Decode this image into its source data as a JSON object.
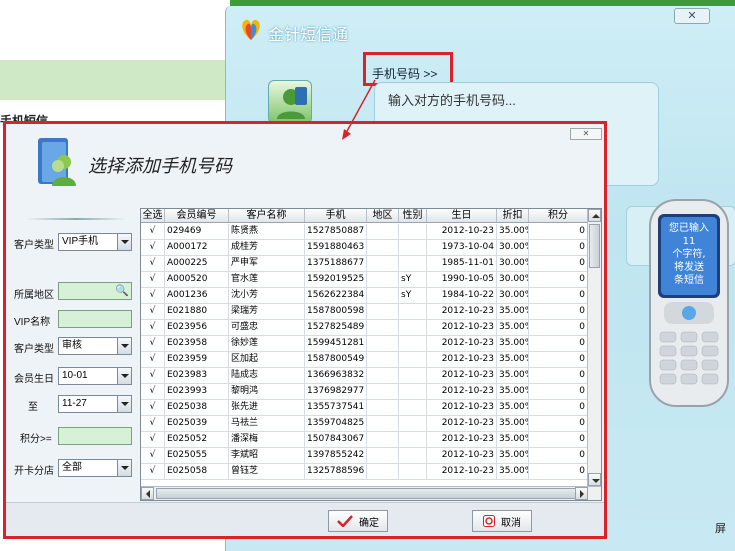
{
  "app": {
    "title": "金针短信通",
    "bg_left_label": "手机短信",
    "phone_link": "手机号码 >>",
    "phone_input_placeholder": "输入对方的手机号码...",
    "bg_bottom_text": "屏"
  },
  "phone_screen": {
    "lines": [
      "您已输入",
      "11",
      "个字符,",
      "将发送",
      "条短信"
    ]
  },
  "dialog": {
    "title": "选择添加手机号码",
    "filters": {
      "customer_type_label": "客户类型",
      "customer_type_value": "VIP手机",
      "region_label": "所属地区",
      "vip_name_label": "VIP名称",
      "customer_type2_label": "客户类型",
      "customer_type2_value": "审核",
      "birthday_label": "会员生日",
      "birthday_from": "10-01",
      "to_label": "至",
      "birthday_to": "11-27",
      "points_label": "积分>=",
      "store_label": "开卡分店",
      "store_value": "全部"
    },
    "table": {
      "columns": [
        "全选",
        "会员编号",
        "客户名称",
        "手机",
        "地区",
        "性别",
        "生日",
        "折扣",
        "积分"
      ],
      "rows": [
        [
          "√",
          "029469",
          "陈贤燕",
          "1527850887",
          "",
          "",
          "2012-10-23",
          "35.00%",
          "0"
        ],
        [
          "√",
          "A000172",
          "成桂芳",
          "1591880463",
          "",
          "",
          "1973-10-04",
          "30.00%",
          "0"
        ],
        [
          "√",
          "A000225",
          "严申军",
          "1375188677",
          "",
          "",
          "1985-11-01",
          "30.00%",
          "0"
        ],
        [
          "√",
          "A000520",
          "官水莲",
          "1592019525",
          "",
          "sY",
          "1990-10-05",
          "30.00%",
          "0"
        ],
        [
          "√",
          "A001236",
          "沈小芳",
          "1562622384",
          "",
          "sY",
          "1984-10-22",
          "30.00%",
          "0"
        ],
        [
          "√",
          "E021880",
          "梁瑞芳",
          "1587800598",
          "",
          "",
          "2012-10-23",
          "35.00%",
          "0"
        ],
        [
          "√",
          "E023956",
          "可盛忠",
          "1527825489",
          "",
          "",
          "2012-10-23",
          "35.00%",
          "0"
        ],
        [
          "√",
          "E023958",
          "徐妙莲",
          "1599451281",
          "",
          "",
          "2012-10-23",
          "35.00%",
          "0"
        ],
        [
          "√",
          "E023959",
          "区加起",
          "1587800549",
          "",
          "",
          "2012-10-23",
          "35.00%",
          "0"
        ],
        [
          "√",
          "E023983",
          "陆成志",
          "1366963832",
          "",
          "",
          "2012-10-23",
          "35.00%",
          "0"
        ],
        [
          "√",
          "E023993",
          "黎明鸿",
          "1376982977",
          "",
          "",
          "2012-10-23",
          "35.00%",
          "0"
        ],
        [
          "√",
          "E025038",
          "张先进",
          "1355737541",
          "",
          "",
          "2012-10-23",
          "35.00%",
          "0"
        ],
        [
          "√",
          "E025039",
          "马祛兰",
          "1359704825",
          "",
          "",
          "2012-10-23",
          "35.00%",
          "0"
        ],
        [
          "√",
          "E025052",
          "潘深梅",
          "1507843067",
          "",
          "",
          "2012-10-23",
          "35.00%",
          "0"
        ],
        [
          "√",
          "E025055",
          "李斌昭",
          "1397855242",
          "",
          "",
          "2012-10-23",
          "35.00%",
          "0"
        ],
        [
          "√",
          "E025058",
          "曾钰芝",
          "1325788596",
          "",
          "",
          "2012-10-23",
          "35.00%",
          "0"
        ]
      ]
    },
    "ok_label": "确定",
    "cancel_label": "取消"
  },
  "colors": {
    "highlight_red": "#d8232a",
    "window_bg": "#c6e8f2",
    "input_green": "#d7f0d8"
  }
}
